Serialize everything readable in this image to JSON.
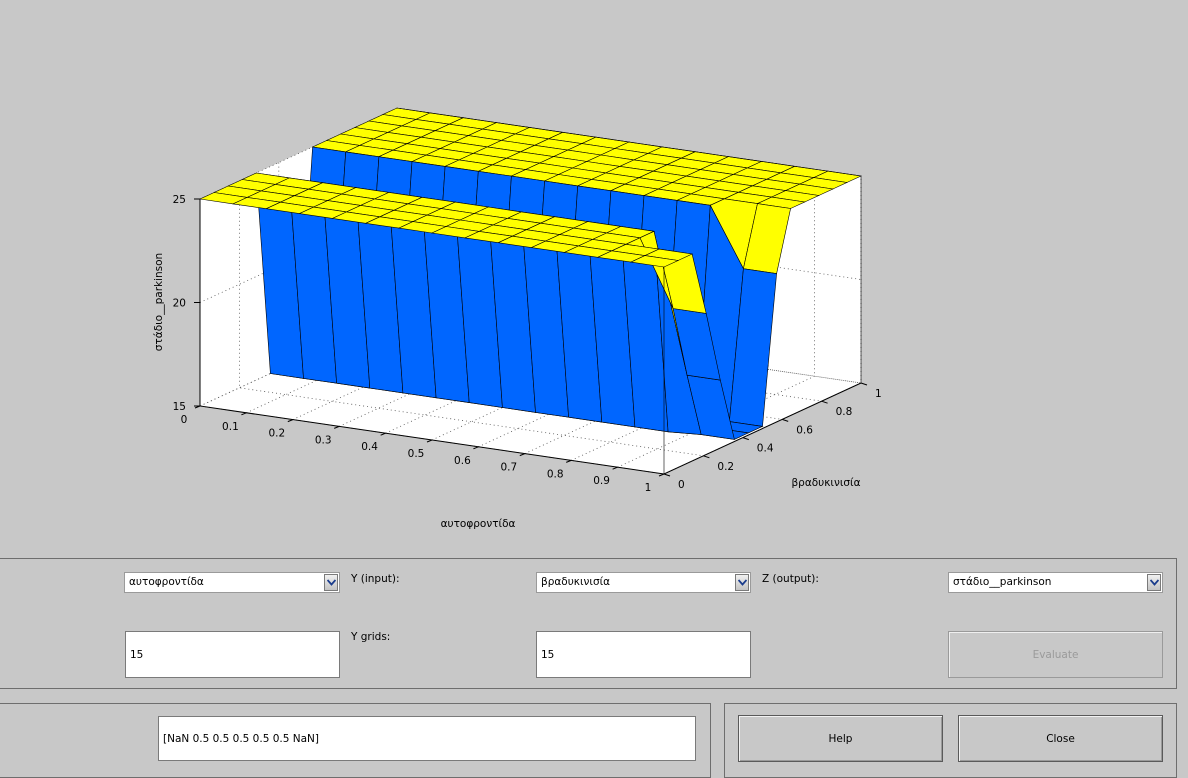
{
  "plot": {
    "x_label": "αυτοφροντίδα",
    "y_label": "βραδυκινισία",
    "z_label": "στάδιο__parkinson",
    "x_ticks": [
      "0",
      "0.1",
      "0.2",
      "0.3",
      "0.4",
      "0.5",
      "0.6",
      "0.7",
      "0.8",
      "0.9",
      "1"
    ],
    "y_ticks": [
      "0",
      "0.2",
      "0.4",
      "0.6",
      "0.8",
      "1"
    ],
    "z_ticks": [
      "15",
      "20",
      "25"
    ],
    "surface_colors": {
      "high": "#ffff00",
      "low": "#0066ff"
    }
  },
  "controls": {
    "x_input_value": "αυτοφροντίδα",
    "y_input_label": "Y (input):",
    "y_input_value": "βραδυκινισία",
    "z_output_label": "Z (output):",
    "z_output_value": "στάδιο__parkinson",
    "x_grids_value": "15",
    "y_grids_label": "Y grids:",
    "y_grids_value": "15",
    "evaluate_label": "Evaluate",
    "ref_input_value": "[NaN 0.5 0.5 0.5 0.5 0.5 NaN]",
    "help_label": "Help",
    "close_label": "Close"
  }
}
